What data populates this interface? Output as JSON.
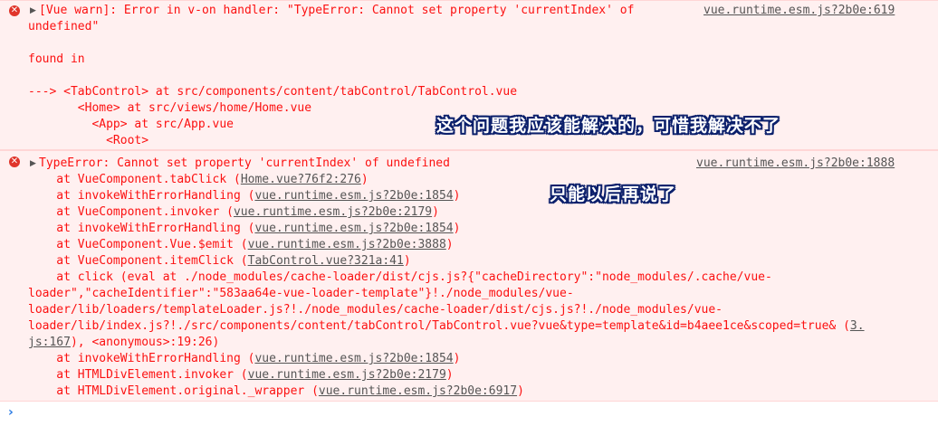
{
  "error1": {
    "line1a": "[Vue warn]: Error in v-on handler: \"TypeError: Cannot set property 'currentIndex' of",
    "line1b": "undefined\"",
    "found_in": "found in",
    "trace": [
      "---> <TabControl> at src/components/content/tabControl/TabControl.vue",
      "       <Home> at src/views/home/Home.vue",
      "         <App> at src/App.vue",
      "           <Root>"
    ],
    "source": "vue.runtime.esm.js?2b0e:619"
  },
  "error2": {
    "title": "TypeError: Cannot set property 'currentIndex' of undefined",
    "source": "vue.runtime.esm.js?2b0e:1888",
    "stack": [
      {
        "text": "    at VueComponent.tabClick (",
        "link": "Home.vue?76f2:276",
        "end": ")"
      },
      {
        "text": "    at invokeWithErrorHandling (",
        "link": "vue.runtime.esm.js?2b0e:1854",
        "end": ")"
      },
      {
        "text": "    at VueComponent.invoker (",
        "link": "vue.runtime.esm.js?2b0e:2179",
        "end": ")"
      },
      {
        "text": "    at invokeWithErrorHandling (",
        "link": "vue.runtime.esm.js?2b0e:1854",
        "end": ")"
      },
      {
        "text": "    at VueComponent.Vue.$emit (",
        "link": "vue.runtime.esm.js?2b0e:3888",
        "end": ")"
      },
      {
        "text": "    at VueComponent.itemClick (",
        "link": "TabControl.vue?321a:41",
        "end": ")"
      }
    ],
    "click_lines": [
      "    at click (eval at ./node_modules/cache-loader/dist/cjs.js?{\"cacheDirectory\":\"node_modules/.cache/vue-",
      "loader\",\"cacheIdentifier\":\"583aa64e-vue-loader-template\"}!./node_modules/vue-",
      "loader/lib/loaders/templateLoader.js?!./node_modules/cache-loader/dist/cjs.js?!./node_modules/vue-",
      "loader/lib/index.js?!./src/components/content/tabControl/TabControl.vue?vue&type=template&id=b4aee1ce&scoped=true& ("
    ],
    "click_link_a": "3.",
    "click_link_b": "js:167",
    "click_tail": "), <anonymous>:19:26)",
    "stack2": [
      {
        "text": "    at invokeWithErrorHandling (",
        "link": "vue.runtime.esm.js?2b0e:1854",
        "end": ")"
      },
      {
        "text": "    at HTMLDivElement.invoker (",
        "link": "vue.runtime.esm.js?2b0e:2179",
        "end": ")"
      },
      {
        "text": "    at HTMLDivElement.original._wrapper (",
        "link": "vue.runtime.esm.js?2b0e:6917",
        "end": ")"
      }
    ]
  },
  "annotations": {
    "a1": "这个问题我应该能解决的，可惜我解决不了",
    "a2": "只能以后再说了"
  },
  "prompt": {
    "chevron": "›"
  },
  "colors": {
    "error_text": "#fc1111",
    "error_bg": "#fff0f0",
    "link": "#555555",
    "prompt": "#2a7be4"
  },
  "icons": {
    "error": "error-icon",
    "expand": "expand-triangle-icon",
    "prompt": "chevron-right-icon"
  }
}
